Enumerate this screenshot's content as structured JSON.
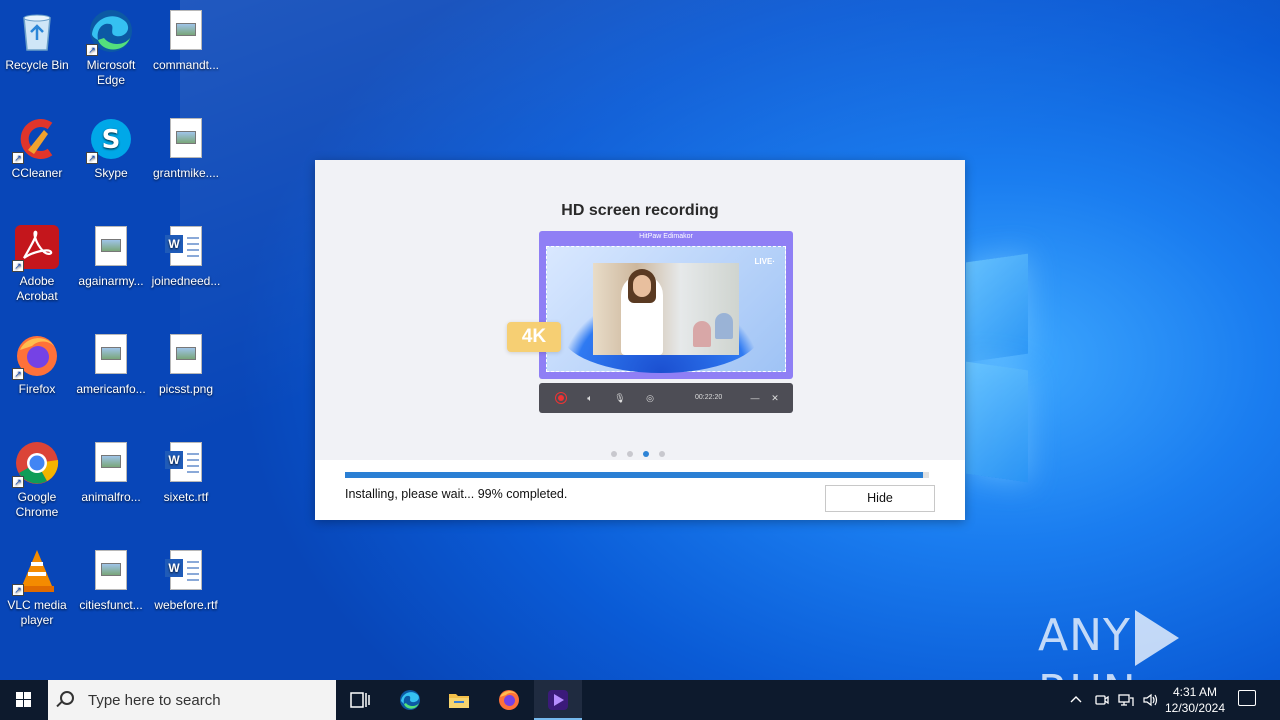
{
  "desktop": {
    "icons": [
      {
        "label": "Recycle Bin"
      },
      {
        "label": "Microsoft Edge"
      },
      {
        "label": "commandt..."
      },
      {
        "label": "CCleaner"
      },
      {
        "label": "Skype"
      },
      {
        "label": "grantmike...."
      },
      {
        "label": "Adobe Acrobat"
      },
      {
        "label": "againarmy..."
      },
      {
        "label": "joinedneed..."
      },
      {
        "label": "Firefox"
      },
      {
        "label": "americanfo..."
      },
      {
        "label": "picsst.png"
      },
      {
        "label": "Google Chrome"
      },
      {
        "label": "animalfro..."
      },
      {
        "label": "sixetc.rtf"
      },
      {
        "label": "VLC media player"
      },
      {
        "label": "citiesfunct..."
      },
      {
        "label": "webefore.rtf"
      }
    ]
  },
  "installer": {
    "slide_title": "HD screen recording",
    "app_name": "HitPaw Edimakor",
    "live_label": "LIVE·",
    "badge": "4K",
    "timer": "00:22:20",
    "carousel": {
      "count": 4,
      "active": 3
    },
    "progress_fraction": 0.99,
    "status": "Installing, please wait... 99% completed.",
    "hide_label": "Hide"
  },
  "watermark": {
    "left": "ANY",
    "right": "RUN"
  },
  "taskbar": {
    "search_placeholder": "Type here to search",
    "apps": [
      "task-view-icon",
      "edge-icon",
      "file-explorer-icon",
      "firefox-icon",
      "hitpaw-icon"
    ],
    "clock_time": "4:31 AM",
    "clock_date": "12/30/2024"
  },
  "colors": {
    "accent": "#2a7fd4",
    "badge": "#f6cf73",
    "frame": "#8f7ff5"
  }
}
